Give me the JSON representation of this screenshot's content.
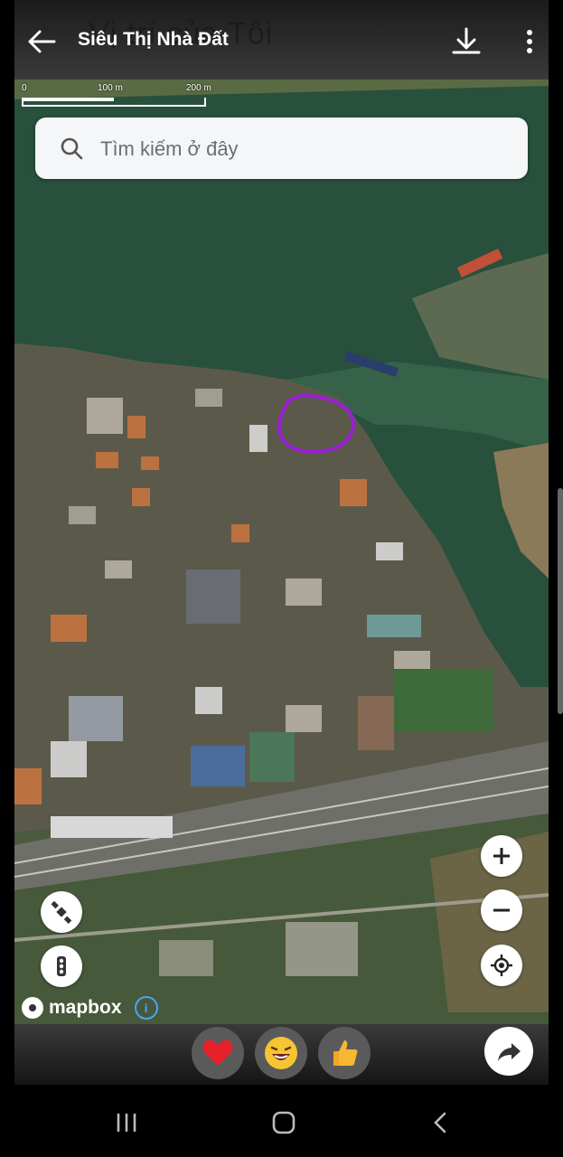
{
  "ghost_title": "Vị trí của Tôi",
  "header": {
    "title": "Siêu Thị Nhà Đất",
    "back_icon": "arrow-left-icon",
    "download_icon": "download-icon",
    "more_icon": "more-vertical-icon"
  },
  "scale": {
    "labels": [
      "0",
      "100 m",
      "200 m"
    ]
  },
  "search": {
    "placeholder": "Tìm kiếm ở đây",
    "value": ""
  },
  "map_controls": {
    "left": [
      {
        "name": "satellite-icon"
      },
      {
        "name": "traffic-light-icon"
      }
    ],
    "right": [
      {
        "name": "zoom-in-icon"
      },
      {
        "name": "zoom-out-icon"
      },
      {
        "name": "locate-icon"
      }
    ]
  },
  "attribution": {
    "logo_text": "mapbox",
    "info_icon": "info-icon",
    "info_text": "i"
  },
  "reactions": [
    {
      "name": "heart-reaction",
      "icon": "heart-icon"
    },
    {
      "name": "laugh-reaction",
      "icon": "laughing-face-icon"
    },
    {
      "name": "like-reaction",
      "icon": "thumbs-up-icon"
    }
  ],
  "share_icon": "share-icon",
  "android_nav": {
    "recents": "recents-icon",
    "home": "home-icon",
    "back": "back-icon"
  },
  "colors": {
    "river": "#28503d",
    "highlight_circle": "#9b1fd6",
    "header_bg": "#1b1b1b",
    "search_bg": "#f5f6f7"
  }
}
